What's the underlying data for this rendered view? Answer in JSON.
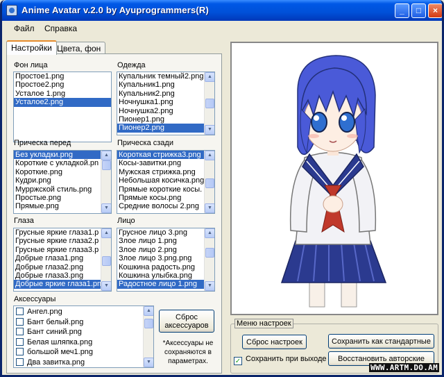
{
  "window": {
    "title": "Anime Avatar v.2.0 by Ayuprogrammers(R)",
    "controls": {
      "minimize": "_",
      "maximize": "□",
      "close": "×"
    }
  },
  "menu": [
    "Файл",
    "Справка"
  ],
  "tabs": [
    {
      "label": "Настройки",
      "active": true
    },
    {
      "label": "Цвета, фон",
      "active": false
    }
  ],
  "lists": {
    "face_bg": {
      "label": "Фон лица",
      "items": [
        "Простое1.png",
        "Простое2.png",
        "Усталое 1.png",
        "Усталое2.png"
      ],
      "selected": 3
    },
    "clothes": {
      "label": "Одежда",
      "items": [
        "Купальник темный2.png",
        "Купальник1.png",
        "Купальник2.png",
        "Ночнушка1.png",
        "Ночнушка2.png",
        "Пионер1.png",
        "Пионер2.png"
      ],
      "selected": 6
    },
    "hair_front": {
      "label": "Прическа перед",
      "items": [
        "Без укладки.png",
        "Короткие с укладкой.pn",
        "Короткие.png",
        "Кудри.png",
        "Мурржской стиль.png",
        "Простые.png",
        "Прямые.png"
      ],
      "selected": 0
    },
    "hair_back": {
      "label": "Прическа сзади",
      "items": [
        "Короткая стрижка3.png",
        "Косы-завитки.png",
        "Мужская стрижка.png",
        "Небольшая косичка.png",
        "Прямые короткие косы.",
        "Прямые косы.png",
        "Средние волосы 2.png"
      ],
      "selected": 0
    },
    "eyes": {
      "label": "Глаза",
      "items": [
        "Грусные яркие глаза1.p",
        "Грусные яркие глаза2.p",
        "Грусные яркие глаза3.p",
        "Добрые глаза1.png",
        "Добрые глаза2.png",
        "Добрые глаза3.png",
        "Добрые яркие глаза1.pn"
      ],
      "selected": 6
    },
    "face": {
      "label": "Лицо",
      "items": [
        "Грусное лицо 3.png",
        "Злое лицо 1.png",
        "Злое лицо 2.png",
        "Злое лицо 3.png.png",
        "Кошкина радость.png",
        "Кошкина улыбка.png",
        "Радостное лицо 1.png"
      ],
      "selected": 6
    },
    "accessories": {
      "label": "Аксессуары",
      "items": [
        "Ангел.png",
        "Бант белый.png",
        "Бант синий.png",
        "Белая шляпка.png",
        "большой меч1.png",
        "Два завитка.png"
      ]
    }
  },
  "buttons": {
    "reset_accessories": "Сброс аксессуаров",
    "reset_settings": "Сброс настроек",
    "save_default": "Сохранить как стандартные",
    "restore_author": "Восстановить авторские"
  },
  "accessories_note": "*Аксессуары не сохраняются в параметрах.",
  "settings_menu": {
    "legend": "Меню настроек",
    "save_on_exit_label": "Сохранить при выходе",
    "save_on_exit_checked": true
  },
  "watermark": "WWW.ARTM.DO.AM",
  "colors": {
    "titlebar": "#0058e6",
    "selection": "#316ac5",
    "uniform_navy": "#2b3a8f",
    "neckerchief": "#c0392b",
    "hair": "#4a5ad8"
  }
}
